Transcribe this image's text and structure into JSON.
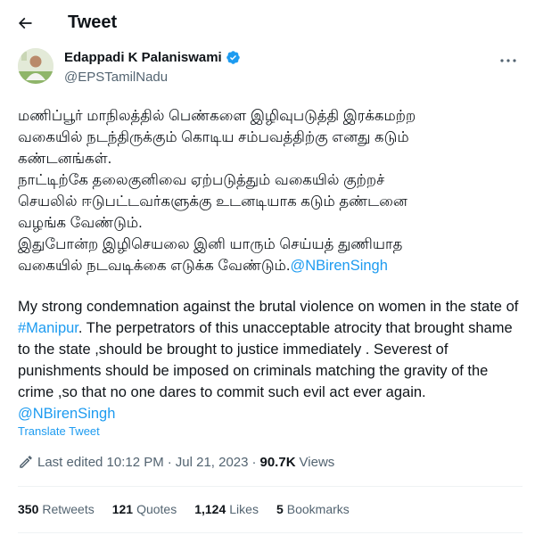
{
  "header": {
    "title": "Tweet"
  },
  "author": {
    "name": "Edappadi K Palaniswami",
    "handle": "@EPSTamilNadu"
  },
  "tweet": {
    "tamil_lines": [
      "மணிப்பூர் மாநிலத்தில் பெண்களை இழிவுபடுத்தி இரக்கமற்ற",
      "வகையில் நடந்திருக்கும் கொடிய சம்பவத்திற்கு எனது கடும்",
      "கண்டனங்கள்.",
      "நாட்டிற்கே தலைகுனிவை ஏற்படுத்தும் வகையில்  குற்றச்",
      "செயலில் ஈடுபட்டவர்களுக்கு உடனடியாக கடும் தண்டனை",
      "வழங்க வேண்டும்.",
      "இதுபோன்ற இழிசெயலை இனி யாரும் செய்யத் துணியாத"
    ],
    "tamil_last_line": "வகையில் நடவடிக்கை எடுக்க வேண்டும்.",
    "mention": "@NBirenSingh",
    "english_part1": "My strong condemnation against the brutal violence on women in the state of ",
    "hashtag": "#Manipur",
    "english_part2": ". The perpetrators of this unacceptable atrocity that brought shame to the state ,should be brought to justice immediately . Severest of punishments should be imposed on criminals matching the gravity of the crime ,so that no one dares to commit such evil act ever again. ",
    "translate_label": "Translate Tweet"
  },
  "meta": {
    "edited_label": "Last edited 10:12 PM",
    "separator": "·",
    "date": "Jul 21, 2023",
    "views_count": "90.7K",
    "views_label": "Views"
  },
  "stats": [
    {
      "count": "350",
      "label": "Retweets"
    },
    {
      "count": "121",
      "label": "Quotes"
    },
    {
      "count": "1,124",
      "label": "Likes"
    },
    {
      "count": "5",
      "label": "Bookmarks"
    }
  ],
  "colors": {
    "accent": "#1d9bf0",
    "text": "#0f1419",
    "secondary": "#536471"
  },
  "icons": {
    "back": "arrow-left-icon",
    "verified": "verified-badge-icon",
    "more": "more-horizontal-icon",
    "edit": "pencil-icon"
  }
}
